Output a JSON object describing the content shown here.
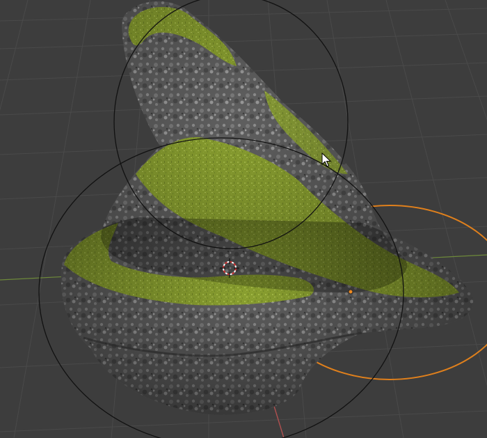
{
  "viewport": {
    "background": "#3d3d3d",
    "grid_color": "#4a4a4a",
    "axis_x_color": "#8a4040",
    "axis_y_color": "#6e8a3a",
    "selection_outline_color": "#e0801c",
    "gizmo_ring_color": "#111111"
  },
  "object": {
    "name": "",
    "material": {
      "rock_base": "#6d6d6d",
      "rock_dark": "#444444",
      "rock_light": "#9a9a9a",
      "moss": "#8aa030",
      "moss_light": "#b0c050",
      "moss_dark": "#5d6b22"
    }
  },
  "icons": {
    "cursor": "mouse-pointer-icon",
    "origin": "3d-cursor-icon",
    "pivot": "object-origin-icon"
  }
}
